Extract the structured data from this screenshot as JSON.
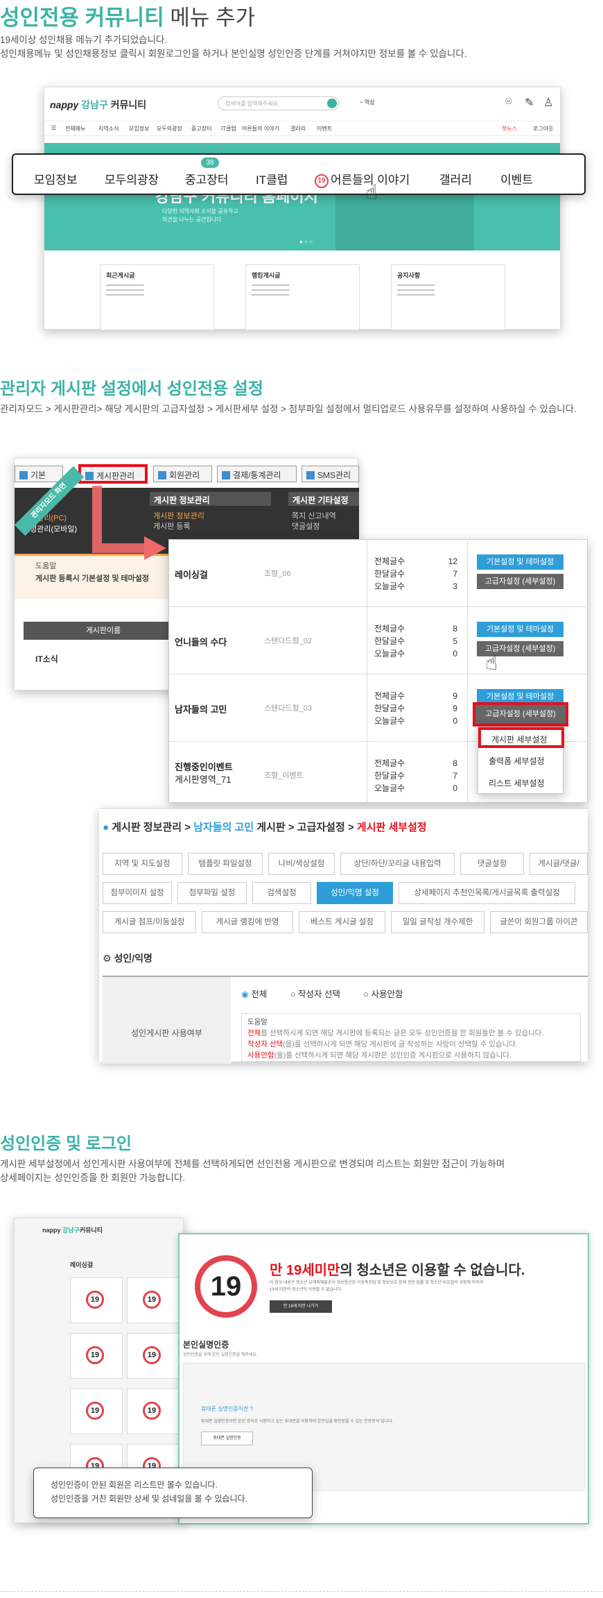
{
  "section1": {
    "title_green": "성인전용 커뮤니티",
    "title_rest": " 메뉴 추가",
    "desc1": "19세이상 성인채용 메뉴기 추가되었습니다.",
    "desc2": "성인채용메뉴 및 성인채용정보 클릭시 회원로그인을 하거나 본인실명 성인인증 단계를 거쳐야지만 정보를 볼 수 있습니다.",
    "logo_brand": "nappy",
    "logo_sub": "강남구",
    "logo_name": "커뮤니티",
    "search_placeholder": "검색어를 입력해주세요.",
    "location": "역삼",
    "small_nav": [
      "전체메뉴",
      "지역소식",
      "모임정보",
      "모두의광장",
      "중고장터",
      "IT클럽",
      "어른들의 이야기",
      "갤러리",
      "이벤트"
    ],
    "right_links": [
      "핫뉴스",
      "로그아웃"
    ],
    "banner_title": "강남구 커뮤니티 홈페이지",
    "banner_sub": "다양한 지역사회 소식을 공유하고",
    "banner_sub2": "의견을 나누는 공간입니다.",
    "cards": [
      {
        "title": "최근게시글"
      },
      {
        "title": "랭킹게시글"
      },
      {
        "title": "공지사항"
      }
    ],
    "popnav": [
      "모임정보",
      "모두의광장",
      "중고장터",
      "IT클럽",
      "어른들의 이야기",
      "갤러리",
      "이벤트"
    ],
    "badge": "38",
    "adult": "19"
  },
  "section2": {
    "title": "관리자 게시판 설정에서 성인전용 설정",
    "desc": "관리자모드 > 게시판관리> 해당 게시판의 고급자설정 > 게시판세부 설정 > 첨부파일 설정에서 멀티업로드 사용유무를 설정하여 사용하실 수 있습니다.",
    "tabs": [
      "기본",
      "게시판관리",
      "회원관리",
      "결제/통계관리",
      "SMS관리"
    ],
    "ribbon": "관리자모드 화면",
    "dark_menus": [
      "게시판 정보관리",
      "게시판 기타설정"
    ],
    "dark_items": [
      "게시판 정보관리",
      "게시판 등록",
      "쪽지 신고내역",
      "댓글설정"
    ],
    "left_items": [
      "설정관리(PC)",
      "설정관리(모바일)",
      "도움말",
      "게시판 등록시 기본설정 및 테마설정",
      "게시판이름",
      "IT소식"
    ],
    "rows": [
      {
        "name": "레이싱걸",
        "skin": "조형_06",
        "total": "12",
        "month": "7",
        "today": "3"
      },
      {
        "name": "언니들의 수다",
        "skin": "스탠다드형_02",
        "total": "8",
        "month": "5",
        "today": "0"
      },
      {
        "name": "남자들의 고민",
        "skin": "스탠다드형_03",
        "total": "9",
        "month": "9",
        "today": "0"
      },
      {
        "name": "진행중인이벤트",
        "name2": "게시판영역_71",
        "skin": "조형_이벤트",
        "total": "8",
        "month": "7",
        "today": "0"
      }
    ],
    "stat_labels": [
      "전체글수",
      "한달글수",
      "오늘글수"
    ],
    "btn_basic": "기본설정 및 테마설정",
    "btn_adv": "고급자설정 (세부설정)",
    "dropdown": [
      "게시판 세부설정",
      "출력폼 세부설정",
      "리스트 세부설정"
    ],
    "crumb": [
      "게시판 정보관리",
      "남자들의 고민",
      "게시판",
      "고급자설정",
      "게시판 세부설정"
    ],
    "setbtns": [
      [
        "지역 및 지도설정",
        "템플릿 파일설정",
        "나비/색상설정",
        "상단/하단/꼬리글 내용입력",
        "댓글설정",
        "게시글/댓글/"
      ],
      [
        "첨부이미지 설정",
        "첨부파일 설정",
        "검색설정",
        "성인/익명 설정",
        "상세페이지 추천인목록/게시글목록 출력설정",
        ""
      ],
      [
        "게시글 점프/이동설정",
        "게시글 랭킹에 반영",
        "베스트 게시글 설정",
        "일일 글작성 개수제한",
        "글쓴이 회원그룹 아이콘"
      ]
    ],
    "section_label": "성인/익명",
    "row_label": "성인게시판 사용여부",
    "radios": [
      "전체",
      "작성자 선택",
      "사용안함"
    ],
    "help": "도움말",
    "help1a": "전체",
    "help1": "를 선택하시게 되면 해당 게시판에 등록되는 글은 모두 성인인증을 한 회원들만 볼 수 있습니다.",
    "help2a": "작성자 선택",
    "help2": "(을)를 선택하시게 되면 해당 게시판에 글 작성하는 사람이 선택할 수 있습니다.",
    "help3a": "사용안함",
    "help3": "(을)를 선택하시게 되면 해당 게시판은 성인인증 게시판으로 사용하지 않습니다."
  },
  "section3": {
    "title": "성인인증 및 로그인",
    "desc1": "게시판 세부설정에서 성인게시판 사용여부에 전체를 선택하게되면 선인전용 게시판으로 변경되며 리스트는 회원만 접근이 가능하며",
    "desc2": "상세페이지는 성인인증을 한 회원만 가능합니다.",
    "mock_title": "레이싱걸",
    "big": "19",
    "warn_red": "만 19세미만",
    "warn_rest": "의 청소년은 이용할 수 없습니다.",
    "warn_small": "이 정보 내용은 청소년 유해매체물로서 정보통신망 이용촉진법 및 정보보호 등에 관한 법률 및 청소년 보호법의 규정에 의하여",
    "warn_small2": "19세 미만의 청소년이 이용할 수 없습니다.",
    "warn_btn": "만 19세 미만 나가기",
    "verify_title": "본인실명인증",
    "verify_sub": "성인인증을 위해 본인 실명인증을 해주세요.",
    "phone_title": "휴대폰 실명인증이란 ?",
    "phone_desc": "휴대폰 실명인증이란 본인 명의로 사용하고 있는 휴대폰을 이용하여 본인임을 확인받을 수 있는 인증방식 입니다.",
    "phone_btn": "휴대폰 실명인증",
    "note1": "성인인증이 안된 회원은 리스트만 볼수 있습니다.",
    "note2": "성인인증을 거친 회원만 상세 및 섬네일을 볼 수 있습니다."
  },
  "colors": {
    "accent": "#3bb3a6",
    "red": "#e5121c",
    "blue": "#2f9ed8"
  }
}
